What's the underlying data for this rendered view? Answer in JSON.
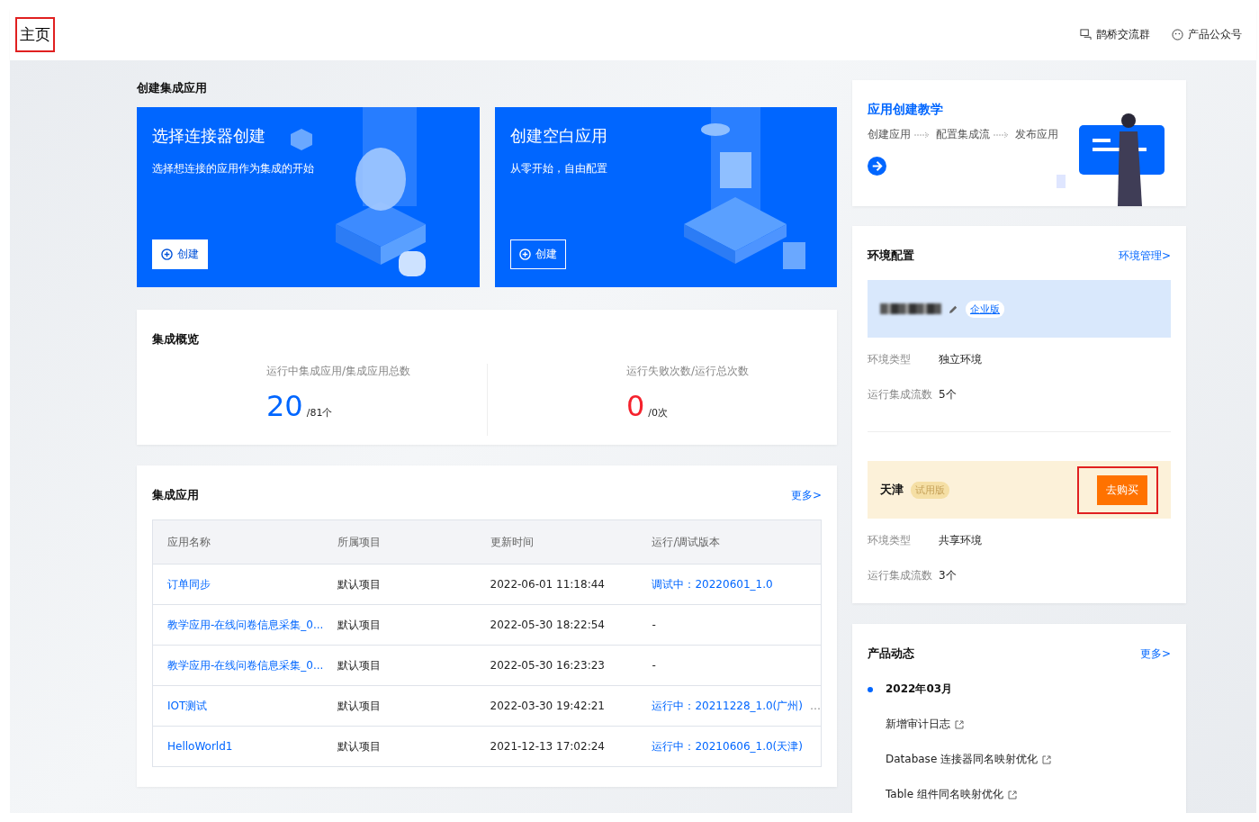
{
  "header": {
    "title": "主页",
    "highlighted": true,
    "links": [
      {
        "label": "鹊桥交流群"
      },
      {
        "label": "产品公众号"
      }
    ]
  },
  "create": {
    "title": "创建集成应用",
    "cards": [
      {
        "title": "选择连接器创建",
        "subtitle": "选择想连接的应用作为集成的开始",
        "button": "创建",
        "kind": "connector"
      },
      {
        "title": "创建空白应用",
        "subtitle": "从零开始，自由配置",
        "button": "创建",
        "kind": "blank"
      }
    ]
  },
  "overview": {
    "title": "集成概览",
    "stats": [
      {
        "label": "运行中集成应用/集成应用总数",
        "value": "20",
        "total": "/81个",
        "color": "#0066ff"
      },
      {
        "label": "运行失败次数/运行总次数",
        "value": "0",
        "total": "/0次",
        "color": "#f5222d"
      }
    ]
  },
  "apps": {
    "title": "集成应用",
    "more": "更多>",
    "columns": [
      "应用名称",
      "所属项目",
      "更新时间",
      "运行/调试版本"
    ],
    "rows": [
      {
        "name": "订单同步",
        "project": "默认项目",
        "updated": "2022-06-01 11:18:44",
        "version": "调试中：20220601_1.0",
        "kind": "link"
      },
      {
        "name": "教学应用-在线问卷信息采集_0...",
        "project": "默认项目",
        "updated": "2022-05-30 18:22:54",
        "version": "-",
        "kind": "plain"
      },
      {
        "name": "教学应用-在线问卷信息采集_0...",
        "project": "默认项目",
        "updated": "2022-05-30 16:23:23",
        "version": "-",
        "kind": "plain"
      },
      {
        "name": "IOT测试",
        "project": "默认项目",
        "updated": "2022-03-30 19:42:21",
        "version": "运行中：20211228_1.0(广州)",
        "kind": "link",
        "extra": "…"
      },
      {
        "name": "HelloWorld1",
        "project": "默认项目",
        "updated": "2021-12-13 17:02:24",
        "version": "运行中：20210606_1.0(天津)",
        "kind": "link"
      }
    ]
  },
  "tutorial": {
    "title": "应用创建教学",
    "steps": [
      "创建应用",
      "配置集成流",
      "发布应用"
    ]
  },
  "environment": {
    "title": "环境配置",
    "manage": "环境管理>",
    "envs": [
      {
        "name_redacted": true,
        "badge": "企业版",
        "kind": "enterprise",
        "fields": [
          {
            "label": "环境类型",
            "value": "独立环境"
          },
          {
            "label": "运行集成流数",
            "value": "5个"
          }
        ]
      },
      {
        "name": "天津",
        "badge": "试用版",
        "kind": "trial",
        "action": "去购买",
        "action_highlighted": true,
        "fields": [
          {
            "label": "环境类型",
            "value": "共享环境"
          },
          {
            "label": "运行集成流数",
            "value": "3个"
          }
        ]
      }
    ]
  },
  "updates": {
    "title": "产品动态",
    "more": "更多>",
    "groups": [
      {
        "month": "2022年03月",
        "items": [
          "新增审计日志",
          "Database 连接器同名映射优化",
          "Table 组件同名映射优化"
        ]
      }
    ]
  }
}
